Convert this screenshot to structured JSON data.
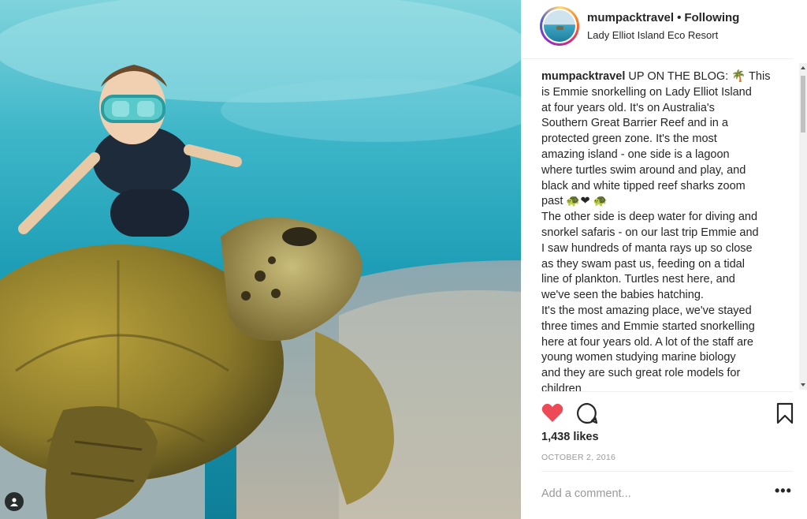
{
  "post": {
    "username": "mumpacktravel",
    "follow_status": "Following",
    "location": "Lady Elliot Island Eco Resort",
    "caption_lines": [
      "UP ON THE BLOG: 🌴 This",
      "is Emmie snorkelling on Lady Elliot Island",
      "at four years old. It's on Australia's",
      "Southern Great Barrier Reef and in a",
      "protected green zone. It's the most",
      "amazing island - one side is a lagoon",
      "where turtles swim around and play, and",
      "black and white tipped reef sharks zoom",
      "past 🐢❤ 🐢",
      "The other side is deep water for diving and",
      "snorkel safaris - on our last trip Emmie and",
      "I saw hundreds of manta rays up so close",
      "as they swam past us, feeding on a tidal",
      "line of plankton. Turtles nest here, and",
      "we've seen the babies hatching.",
      "It's the most amazing place, we've stayed",
      "three times and Emmie started snorkelling",
      "here at four years old. A lot of the staff are",
      "young women studying marine biology",
      "and they are such great role models for",
      "children"
    ],
    "likes": "1,438 likes",
    "date": "OCTOBER 2, 2016",
    "comment_placeholder": "Add a comment...",
    "more_label": "•••"
  },
  "icons": {
    "heart": "heart-icon",
    "comment": "comment-icon",
    "bookmark": "bookmark-icon",
    "tag": "user-tag-icon",
    "heart_color": "#ed4956"
  }
}
